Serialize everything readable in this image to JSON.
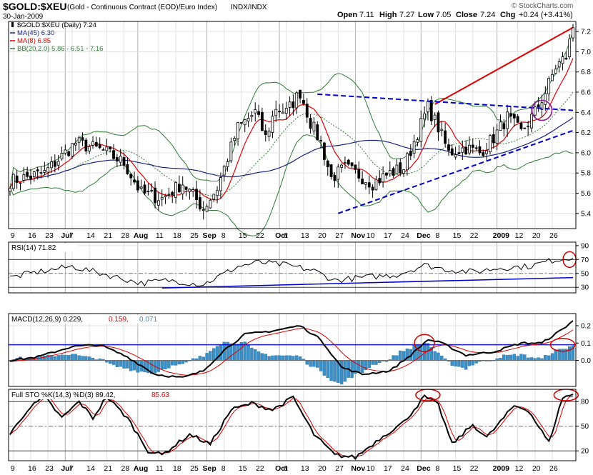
{
  "header": {
    "symbol": "$GOLD:$XEU",
    "description": "(Gold - Continuous Contract (EOD)/Euro Index)",
    "exchange": "INDX/INDX",
    "date": "30-Jan-2009",
    "watermark": "© StockCharts.com",
    "ohlc": {
      "open_label": "Open",
      "open": "7.11",
      "high_label": "High",
      "high": "7.27",
      "low_label": "Low",
      "low": "7.05",
      "close_label": "Close",
      "close": "7.24",
      "chg_label": "Chg",
      "chg": "+0.24 (+3.41%)"
    }
  },
  "colors": {
    "candle": "#000000",
    "ma_long": "#1a237e",
    "ma_short": "#e00000",
    "bollinger": "#2e7d32",
    "trend_red": "#e00000",
    "trend_blue": "#0000cc",
    "macd_hist": "#3b8fc7",
    "annotation": "#cc0000",
    "annotation_purple": "#8b1a8b",
    "grid": "#d0d0d0"
  },
  "chart_data": [
    {
      "type": "candlestick",
      "panel": "price",
      "legend": [
        {
          "label": "$GOLD:$XEU (Daily) 7.24",
          "color": "#000000"
        },
        {
          "label": "MA(45) 6.30",
          "color": "#1a237e"
        },
        {
          "label": "MA(8) 6.85",
          "color": "#e00000"
        },
        {
          "label": "BB(20,2.0) 5.86 - 6.51 - 7.16",
          "color": "#2e7d32"
        }
      ],
      "ylim": [
        5.25,
        7.3
      ],
      "yticks": [
        5.4,
        5.6,
        5.8,
        6.0,
        6.2,
        6.4,
        6.6,
        6.8,
        7.0,
        7.2
      ],
      "ytick_labels": [
        "5.4",
        "5.6",
        "5.8",
        "6.0",
        "6.2",
        "6.4",
        "6.6",
        "6.8",
        "7.0",
        "7.2"
      ],
      "close_anchors": [
        [
          0,
          5.72
        ],
        [
          10,
          5.8
        ],
        [
          19,
          6.1
        ],
        [
          27,
          6.02
        ],
        [
          33,
          5.9
        ],
        [
          38,
          5.6
        ],
        [
          44,
          5.55
        ],
        [
          50,
          5.7
        ],
        [
          56,
          5.45
        ],
        [
          60,
          5.65
        ],
        [
          66,
          6.25
        ],
        [
          71,
          6.4
        ],
        [
          74,
          6.15
        ],
        [
          77,
          6.45
        ],
        [
          80,
          6.4
        ],
        [
          84,
          6.6
        ],
        [
          87,
          6.3
        ],
        [
          90,
          6.1
        ],
        [
          93,
          5.75
        ],
        [
          97,
          5.85
        ],
        [
          101,
          5.78
        ],
        [
          105,
          5.7
        ],
        [
          110,
          5.8
        ],
        [
          114,
          5.85
        ],
        [
          118,
          6.2
        ],
        [
          121,
          6.45
        ],
        [
          124,
          6.25
        ],
        [
          127,
          6.0
        ],
        [
          132,
          6.05
        ],
        [
          136,
          6.0
        ],
        [
          140,
          6.15
        ],
        [
          144,
          6.35
        ],
        [
          148,
          6.2
        ],
        [
          152,
          6.4
        ],
        [
          155,
          6.6
        ],
        [
          158,
          6.85
        ],
        [
          161,
          6.95
        ],
        [
          163,
          7.24
        ]
      ],
      "trendlines": [
        {
          "color": "red",
          "style": "solid",
          "from": [
            123,
            6.48
          ],
          "to": [
            163,
            7.24
          ]
        },
        {
          "color": "blue",
          "style": "dashed",
          "from": [
            89,
            6.58
          ],
          "to": [
            163,
            6.42
          ]
        },
        {
          "color": "blue",
          "style": "dashed",
          "from": [
            95,
            5.4
          ],
          "to": [
            163,
            6.22
          ]
        }
      ]
    },
    {
      "type": "line",
      "panel": "rsi",
      "label": "RSI(14) 71.82",
      "ylim": [
        22,
        95
      ],
      "yticks": [
        30,
        50,
        70,
        90
      ],
      "ytick_labels": [
        "30",
        "50",
        "70",
        "90"
      ],
      "overbought": 70,
      "oversold": 30,
      "anchors": [
        [
          0,
          44
        ],
        [
          8,
          52
        ],
        [
          18,
          60
        ],
        [
          28,
          48
        ],
        [
          38,
          36
        ],
        [
          46,
          40
        ],
        [
          56,
          34
        ],
        [
          66,
          60
        ],
        [
          72,
          66
        ],
        [
          80,
          62
        ],
        [
          88,
          54
        ],
        [
          94,
          40
        ],
        [
          102,
          44
        ],
        [
          112,
          48
        ],
        [
          120,
          62
        ],
        [
          126,
          56
        ],
        [
          134,
          52
        ],
        [
          142,
          58
        ],
        [
          150,
          60
        ],
        [
          158,
          70
        ],
        [
          163,
          72
        ]
      ],
      "trendline": {
        "from": [
          44,
          29
        ],
        "to": [
          163,
          44
        ]
      }
    },
    {
      "type": "line+bar",
      "panel": "macd",
      "label": "MACD(12,26,9) 0.229, 0.159, 0.071",
      "label_parts": [
        "MACD(12,26,9) 0.229,",
        "0.159,",
        "0.071"
      ],
      "ylim": [
        -0.15,
        0.27
      ],
      "yticks": [
        0.0,
        0.1,
        0.2
      ],
      "ytick_labels": [
        "0.0",
        "0.1",
        "0.2"
      ],
      "signal_level": 0.09,
      "anchors": [
        [
          0,
          0.0
        ],
        [
          8,
          0.02
        ],
        [
          18,
          0.08
        ],
        [
          26,
          0.09
        ],
        [
          34,
          0.02
        ],
        [
          42,
          -0.08
        ],
        [
          50,
          -0.1
        ],
        [
          56,
          -0.06
        ],
        [
          62,
          0.06
        ],
        [
          68,
          0.15
        ],
        [
          76,
          0.17
        ],
        [
          84,
          0.2
        ],
        [
          90,
          0.12
        ],
        [
          96,
          -0.04
        ],
        [
          102,
          -0.08
        ],
        [
          110,
          -0.06
        ],
        [
          116,
          0.03
        ],
        [
          121,
          0.12
        ],
        [
          125,
          0.1
        ],
        [
          132,
          0.03
        ],
        [
          140,
          0.05
        ],
        [
          148,
          0.1
        ],
        [
          154,
          0.1
        ],
        [
          160,
          0.18
        ],
        [
          163,
          0.229
        ]
      ]
    },
    {
      "type": "line",
      "panel": "sto",
      "label": "Full STO %K(14,3) %D(3) 89.42, 85.63",
      "label_parts": [
        "Full STO %K(14,3) %D(3) 89.42,",
        "85.63"
      ],
      "ylim": [
        8,
        95
      ],
      "yticks": [
        20,
        50,
        80
      ],
      "ytick_labels": [
        "20",
        "50",
        "80"
      ],
      "anchors": [
        [
          0,
          40
        ],
        [
          5,
          70
        ],
        [
          10,
          86
        ],
        [
          15,
          60
        ],
        [
          20,
          80
        ],
        [
          24,
          60
        ],
        [
          28,
          86
        ],
        [
          34,
          60
        ],
        [
          40,
          20
        ],
        [
          44,
          15
        ],
        [
          52,
          40
        ],
        [
          58,
          28
        ],
        [
          64,
          70
        ],
        [
          70,
          78
        ],
        [
          76,
          70
        ],
        [
          82,
          85
        ],
        [
          88,
          40
        ],
        [
          94,
          15
        ],
        [
          100,
          12
        ],
        [
          108,
          38
        ],
        [
          114,
          55
        ],
        [
          120,
          86
        ],
        [
          124,
          76
        ],
        [
          128,
          28
        ],
        [
          134,
          52
        ],
        [
          138,
          36
        ],
        [
          146,
          75
        ],
        [
          150,
          70
        ],
        [
          156,
          30
        ],
        [
          160,
          85
        ],
        [
          163,
          89
        ]
      ]
    }
  ],
  "x_axis": {
    "labels": [
      {
        "text": "9",
        "bar": 1
      },
      {
        "text": "16",
        "bar": 6
      },
      {
        "text": "23",
        "bar": 11
      },
      {
        "text": "Jul",
        "bar": 16,
        "bold": true
      },
      {
        "text": "7",
        "bar": 18
      },
      {
        "text": "14",
        "bar": 23
      },
      {
        "text": "21",
        "bar": 28
      },
      {
        "text": "28",
        "bar": 33
      },
      {
        "text": "Aug",
        "bar": 37,
        "bold": true
      },
      {
        "text": "11",
        "bar": 43
      },
      {
        "text": "18",
        "bar": 48
      },
      {
        "text": "25",
        "bar": 53
      },
      {
        "text": "Sep",
        "bar": 57,
        "bold": true
      },
      {
        "text": "8",
        "bar": 62
      },
      {
        "text": "15",
        "bar": 67
      },
      {
        "text": "22",
        "bar": 72
      },
      {
        "text": "Oct",
        "bar": 78,
        "bold": true
      },
      {
        "text": "6",
        "bar": 80
      },
      {
        "text": "13",
        "bar": 85
      },
      {
        "text": "20",
        "bar": 90
      },
      {
        "text": "27",
        "bar": 95
      },
      {
        "text": "Nov",
        "bar": 100,
        "bold": true
      },
      {
        "text": "10",
        "bar": 104
      },
      {
        "text": "17",
        "bar": 109
      },
      {
        "text": "24",
        "bar": 114
      },
      {
        "text": "Dec",
        "bar": 119,
        "bold": true
      },
      {
        "text": "8",
        "bar": 124
      },
      {
        "text": "15",
        "bar": 129
      },
      {
        "text": "22",
        "bar": 134
      },
      {
        "text": "2009",
        "bar": 141,
        "bold": true
      },
      {
        "text": "12",
        "bar": 147
      },
      {
        "text": "20",
        "bar": 152
      },
      {
        "text": "26",
        "bar": 157
      }
    ]
  }
}
